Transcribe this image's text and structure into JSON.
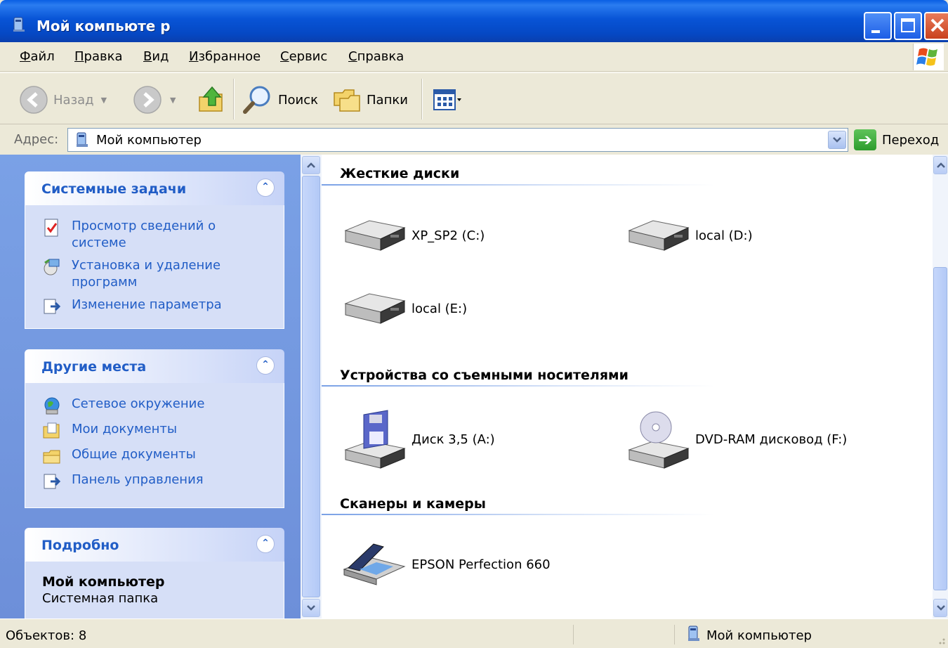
{
  "window": {
    "title": "Мой компьюте р",
    "buttons": {
      "minimize": "minimize",
      "maximize": "maximize",
      "close": "close"
    }
  },
  "menu": {
    "items": [
      {
        "hot": "Ф",
        "rest": "айл"
      },
      {
        "hot": "П",
        "rest": "равка"
      },
      {
        "hot": "В",
        "rest": "ид"
      },
      {
        "hot": "И",
        "rest": "збранное"
      },
      {
        "hot": "С",
        "rest": "ервис",
        "pre": ""
      },
      {
        "hot": "С",
        "rest": "правка"
      }
    ]
  },
  "toolbar": {
    "back_label": "Назад",
    "search_label": "Поиск",
    "folders_label": "Папки"
  },
  "address": {
    "label": "Адрес:",
    "value": "Мой компьютер",
    "go_label": "Переход"
  },
  "tasks": {
    "system": {
      "title": "Системные задачи",
      "items": [
        {
          "label": "Просмотр сведений о системе",
          "icon": "system-info-icon"
        },
        {
          "label": "Установка и удаление программ",
          "icon": "add-remove-programs-icon"
        },
        {
          "label": "Изменение параметра",
          "icon": "control-panel-icon"
        }
      ]
    },
    "places": {
      "title": "Другие места",
      "items": [
        {
          "label": "Сетевое окружение",
          "icon": "network-icon"
        },
        {
          "label": "Мои документы",
          "icon": "my-documents-icon"
        },
        {
          "label": "Общие документы",
          "icon": "shared-documents-icon"
        },
        {
          "label": "Панель управления",
          "icon": "control-panel-icon"
        }
      ]
    },
    "details": {
      "title": "Подробно",
      "name": "Мой компьютер",
      "subtitle": "Системная папка"
    }
  },
  "content": {
    "groups": [
      {
        "title": "Жесткие диски"
      },
      {
        "title": "Устройства со съемными носителями"
      },
      {
        "title": "Сканеры и камеры"
      }
    ],
    "drives": {
      "c": "XP_SP2 (C:)",
      "d": "local (D:)",
      "e": "local (E:)",
      "a": "Диск 3,5 (A:)",
      "f": "DVD-RAM дисковод (F:)",
      "scanner": "EPSON Perfection 660"
    }
  },
  "status": {
    "count": "Объектов: 8",
    "location": "Мой компьютер"
  },
  "colors": {
    "titlebar": "#0854d6",
    "task_link": "#215dc6",
    "task_pane_bg": "#7aa1e6"
  }
}
